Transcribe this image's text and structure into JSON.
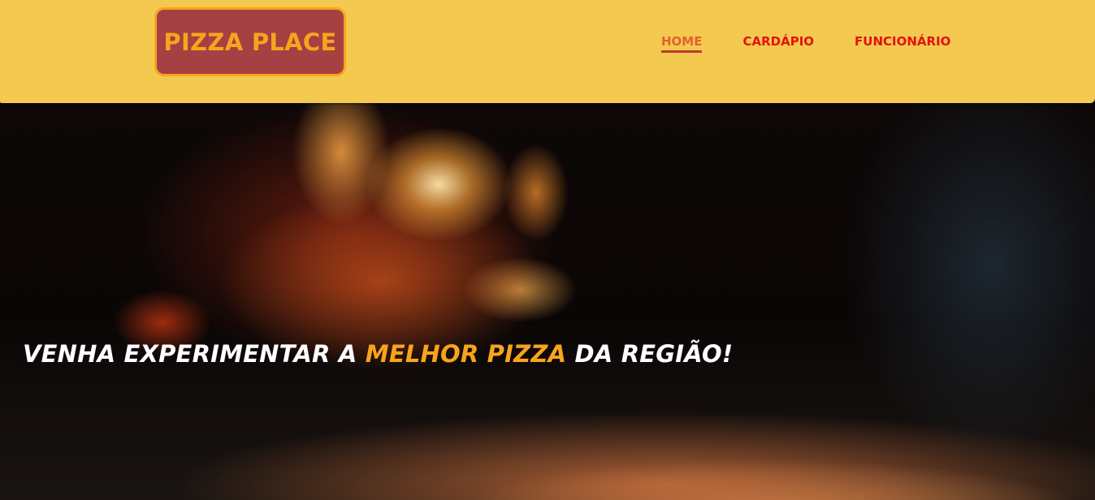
{
  "header": {
    "logo_text": "PIZZA PLACE",
    "nav": [
      {
        "label": "HOME",
        "active": true
      },
      {
        "label": "CARDÁPIO",
        "active": false
      },
      {
        "label": "FUNCIONÁRIO",
        "active": false
      }
    ]
  },
  "hero": {
    "title_before": "VENHA EXPERIMENTAR A ",
    "title_highlight": "MELHOR PIZZA",
    "title_after": " DA REGIÃO!"
  },
  "colors": {
    "header_bg": "#f3c950",
    "logo_bg": "#a54043",
    "logo_text": "#f7a41d",
    "nav_text": "#e3120f",
    "nav_active": "#e5602e",
    "hero_accent": "#f7a41d"
  }
}
